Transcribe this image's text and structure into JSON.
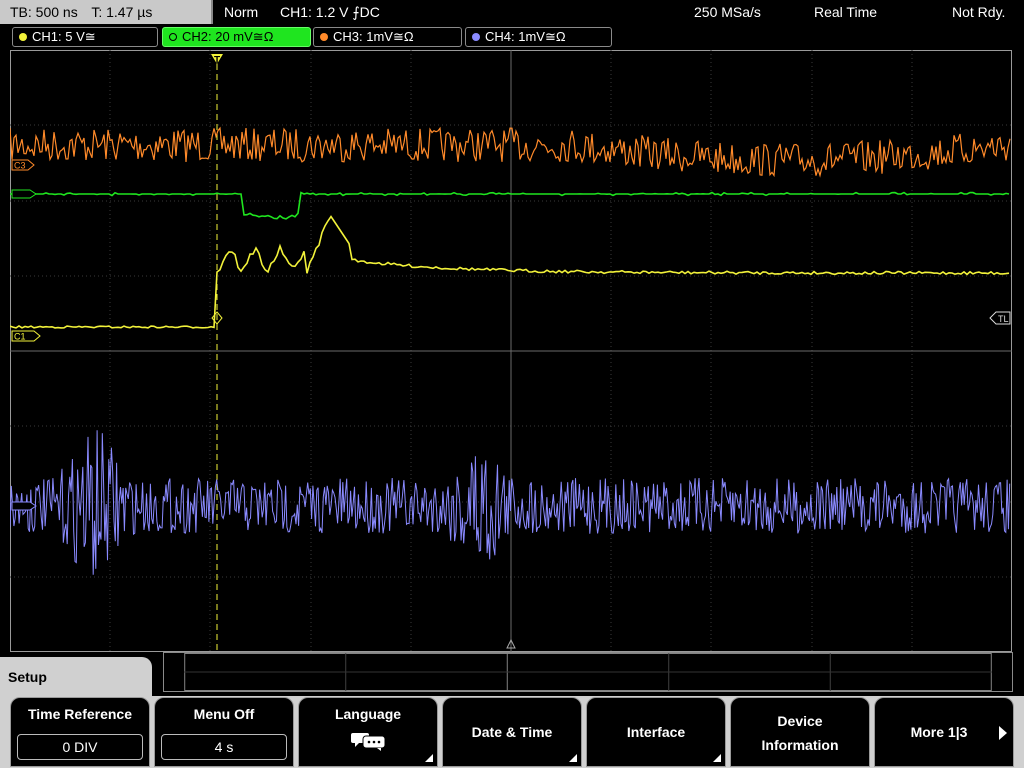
{
  "status": {
    "timebase": "TB: 500 ns",
    "trigger_time": "T: 1.47 µs",
    "mode": "Norm",
    "trigger_info": "CH1: 1.2 V ⨍DC",
    "sample_rate": "250 MSa/s",
    "acq_mode": "Real Time",
    "state": "Not Rdy."
  },
  "channels": [
    {
      "label": "CH1: 5 V≅",
      "color": "#f2f23a"
    },
    {
      "label": "CH2: 20 mV≅Ω",
      "color": "#1fe51f"
    },
    {
      "label": "CH3: 1mV≅Ω",
      "color": "#ff8a2a"
    },
    {
      "label": "CH4: 1mV≅Ω",
      "color": "#8a8aff"
    }
  ],
  "markers": {
    "c3": "C3",
    "c1": "C1",
    "tl": "TL"
  },
  "menu": {
    "title": "Setup",
    "time_reference": {
      "label": "Time Reference",
      "value": "0 DIV"
    },
    "menu_off": {
      "label": "Menu Off",
      "value": "4 s"
    },
    "language": {
      "label": "Language"
    },
    "date_time": {
      "label": "Date & Time"
    },
    "interface": {
      "label": "Interface"
    },
    "device_info": {
      "label1": "Device",
      "label2": "Information"
    },
    "more": {
      "label": "More 1|3"
    }
  },
  "colors": {
    "ch1": "#f2f23a",
    "ch2": "#1fe51f",
    "ch3": "#ff8a2a",
    "ch4": "#8a8aff"
  }
}
